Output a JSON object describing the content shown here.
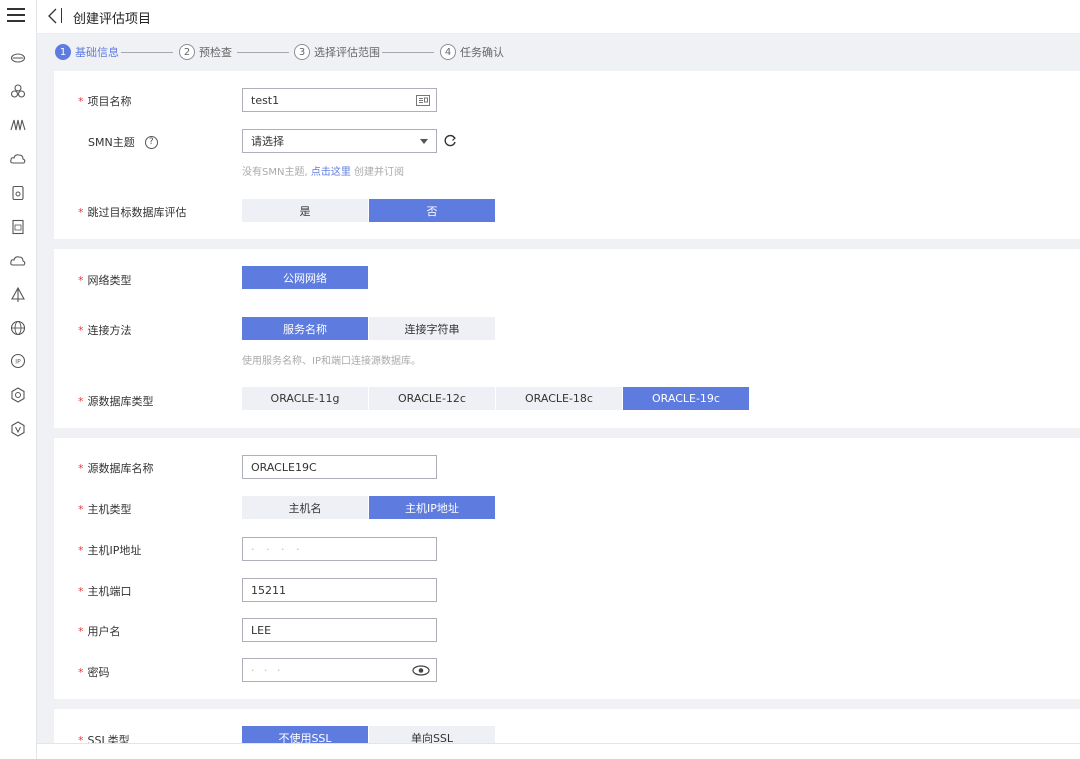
{
  "header": {
    "title": "创建评估项目"
  },
  "steps": [
    {
      "num": "1",
      "label": "基础信息"
    },
    {
      "num": "2",
      "label": "预检查"
    },
    {
      "num": "3",
      "label": "选择评估范围"
    },
    {
      "num": "4",
      "label": "任务确认"
    }
  ],
  "sidebar": {
    "icons": [
      "cloud-server-icon",
      "cluster-icon",
      "network-icon",
      "cloud-db-icon",
      "storage-icon",
      "doc-icon",
      "cloud-icon",
      "cdn-icon",
      "globe-icon",
      "ip-icon",
      "security-icon",
      "shield-icon"
    ]
  },
  "basic": {
    "project_name_label": "项目名称",
    "project_name_value": "test1",
    "smn_label": "SMN主题",
    "smn_placeholder": "请选择",
    "smn_hint_prefix": "没有SMN主题,",
    "smn_hint_link": "点击这里",
    "smn_hint_suffix": "创建并订阅",
    "skip_label": "跳过目标数据库评估",
    "skip_options": [
      "是",
      "否"
    ],
    "skip_selected": 1
  },
  "network": {
    "net_type_label": "网络类型",
    "net_type_options": [
      "公网网络"
    ],
    "conn_label": "连接方法",
    "conn_options": [
      "服务名称",
      "连接字符串"
    ],
    "conn_hint": "使用服务名称、IP和端口连接源数据库。",
    "db_type_label": "源数据库类型",
    "db_type_options": [
      "ORACLE-11g",
      "ORACLE-12c",
      "ORACLE-18c",
      "ORACLE-19c"
    ]
  },
  "source": {
    "db_name_label": "源数据库名称",
    "db_name_value": "ORACLE19C",
    "host_type_label": "主机类型",
    "host_type_options": [
      "主机名",
      "主机IP地址"
    ],
    "host_ip_label": "主机IP地址",
    "port_label": "主机端口",
    "port_value": "15211",
    "user_label": "用户名",
    "user_value": "LEE",
    "password_label": "密码"
  },
  "ssl": {
    "ssl_label": "SSL类型",
    "ssl_options": [
      "不使用SSL",
      "单向SSL"
    ]
  }
}
